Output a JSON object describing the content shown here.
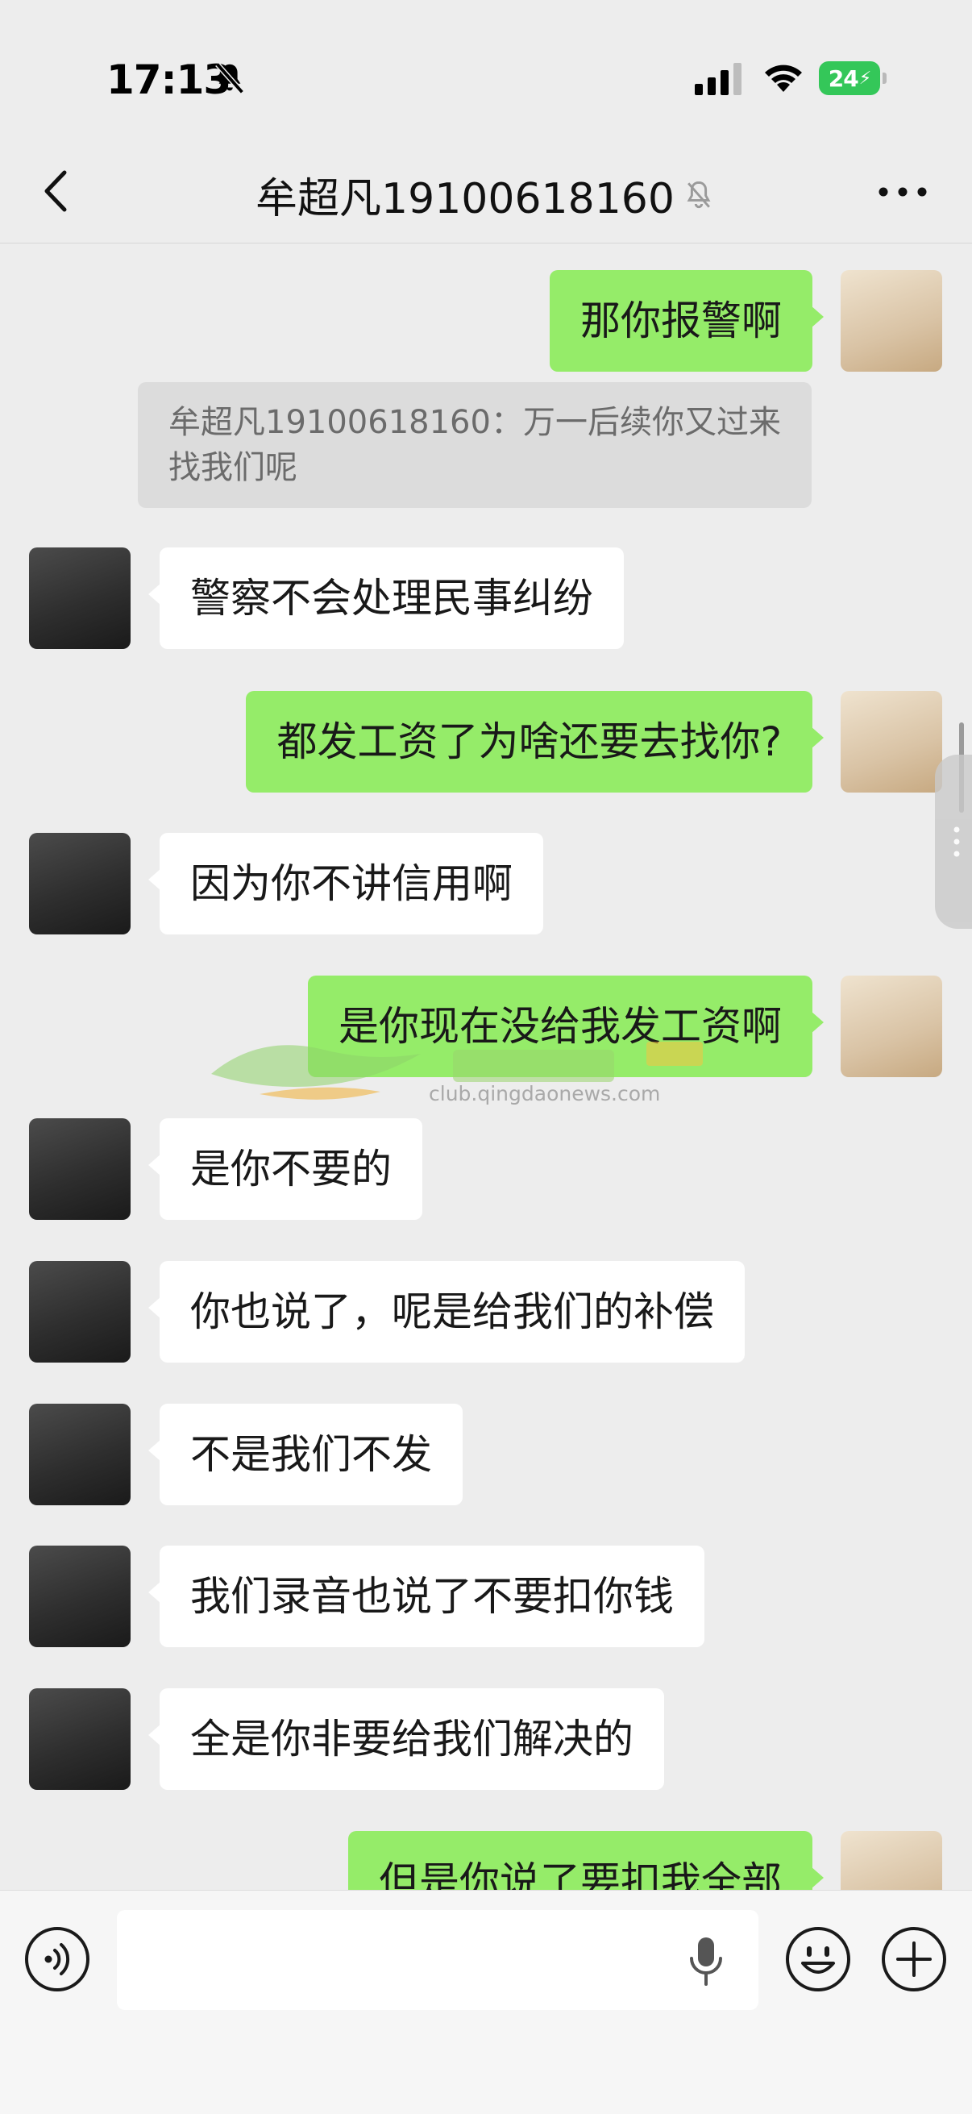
{
  "status_bar": {
    "time": "17:13",
    "battery": "24",
    "icons": [
      "bell-slash-icon",
      "signal-icon",
      "wifi-icon",
      "battery-charging-icon"
    ]
  },
  "nav": {
    "title": "牟超凡19100618160",
    "icons": [
      "back-chevron-icon",
      "bell-slash-icon",
      "more-dots-icon"
    ]
  },
  "colors": {
    "background": "#ededed",
    "self_bubble": "#95ec69",
    "other_bubble": "#ffffff",
    "quote_box": "#dcdcdc"
  },
  "messages": [
    {
      "from": "self",
      "text": "那你报警啊"
    },
    {
      "from": "quote",
      "text": "牟超凡19100618160：万一后续你又过来找我们呢"
    },
    {
      "from": "other",
      "text": "警察不会处理民事纠纷"
    },
    {
      "from": "self",
      "text": "都发工资了为啥还要去找你?"
    },
    {
      "from": "other",
      "text": "因为你不讲信用啊"
    },
    {
      "from": "self",
      "text": "是你现在没给我发工资啊"
    },
    {
      "from": "other",
      "text": "是你不要的"
    },
    {
      "from": "other",
      "text": "你也说了，呢是给我们的补偿"
    },
    {
      "from": "other",
      "text": "不是我们不发"
    },
    {
      "from": "other",
      "text": "我们录音也说了不要扣你钱"
    },
    {
      "from": "other",
      "text": "全是你非要给我们解决的"
    },
    {
      "from": "self",
      "text": "但是你说了要扣我全部"
    }
  ],
  "watermark": {
    "text": "club.qingdaonews.com"
  },
  "input_bar": {
    "placeholder": "",
    "icons": [
      "voice-icon",
      "mic-icon",
      "emoji-icon",
      "plus-icon"
    ]
  }
}
